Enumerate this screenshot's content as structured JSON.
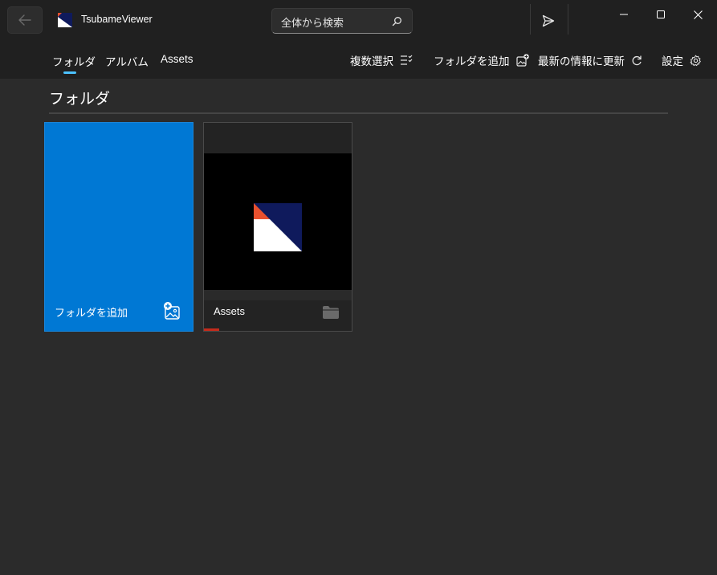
{
  "app": {
    "title": "TsubameViewer"
  },
  "search": {
    "placeholder": "全体から検索"
  },
  "tabs": [
    {
      "label": "フォルダ",
      "selected": true
    },
    {
      "label": "アルバム",
      "selected": false
    },
    {
      "label": "Assets",
      "selected": false
    }
  ],
  "commands": {
    "multi_select": "複数選択",
    "add_folder": "フォルダを追加",
    "refresh": "最新の情報に更新",
    "settings": "設定"
  },
  "section": {
    "title": "フォルダ"
  },
  "tiles": {
    "add": {
      "label": "フォルダを追加"
    },
    "folder": {
      "label": "Assets"
    }
  },
  "colors": {
    "accent": "#0078d4",
    "indicator": "#4cc2ff",
    "progress": "#c42b1c",
    "logo_navy": "#0f1a5c",
    "logo_red": "#e8502e"
  },
  "icons": {
    "back": "arrow-left-icon",
    "search": "search-icon",
    "share": "send-icon",
    "minimize": "minimize-icon",
    "maximize": "maximize-icon",
    "close": "close-icon",
    "multi_select": "checklist-icon",
    "add_folder": "add-image-icon",
    "refresh": "refresh-icon",
    "settings": "gear-icon",
    "folder": "folder-icon"
  }
}
